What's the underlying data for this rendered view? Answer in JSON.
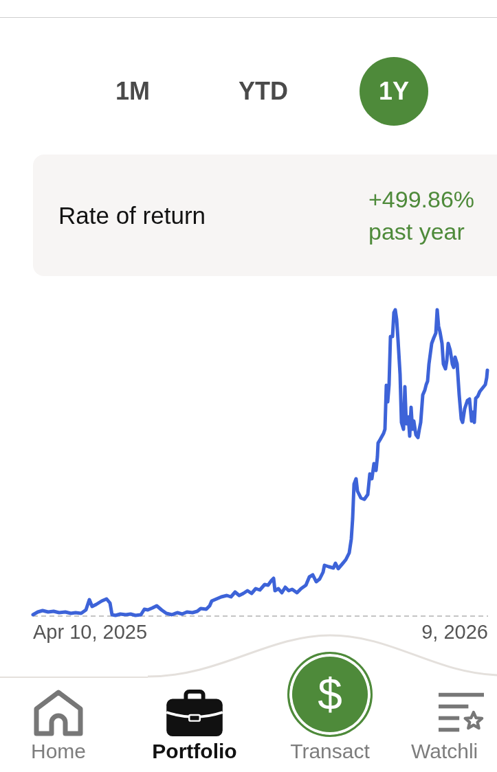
{
  "range_tabs": [
    {
      "label": "1M",
      "selected": false
    },
    {
      "label": "YTD",
      "selected": false
    },
    {
      "label": "1Y",
      "selected": true
    }
  ],
  "return_card": {
    "label": "Rate of return",
    "value": "+499.86%",
    "period": "past year"
  },
  "chart": {
    "start_date": "Apr 10, 2025",
    "end_date": "9, 2026"
  },
  "bottom_nav": [
    {
      "kind": "tab",
      "label": "Home",
      "selected": false
    },
    {
      "kind": "tab",
      "label": "Portfolio",
      "selected": true
    },
    {
      "kind": "action",
      "label": "Transact",
      "symbol": "$",
      "selected": false
    },
    {
      "kind": "tab",
      "label": "Watchli",
      "selected": false
    }
  ]
}
